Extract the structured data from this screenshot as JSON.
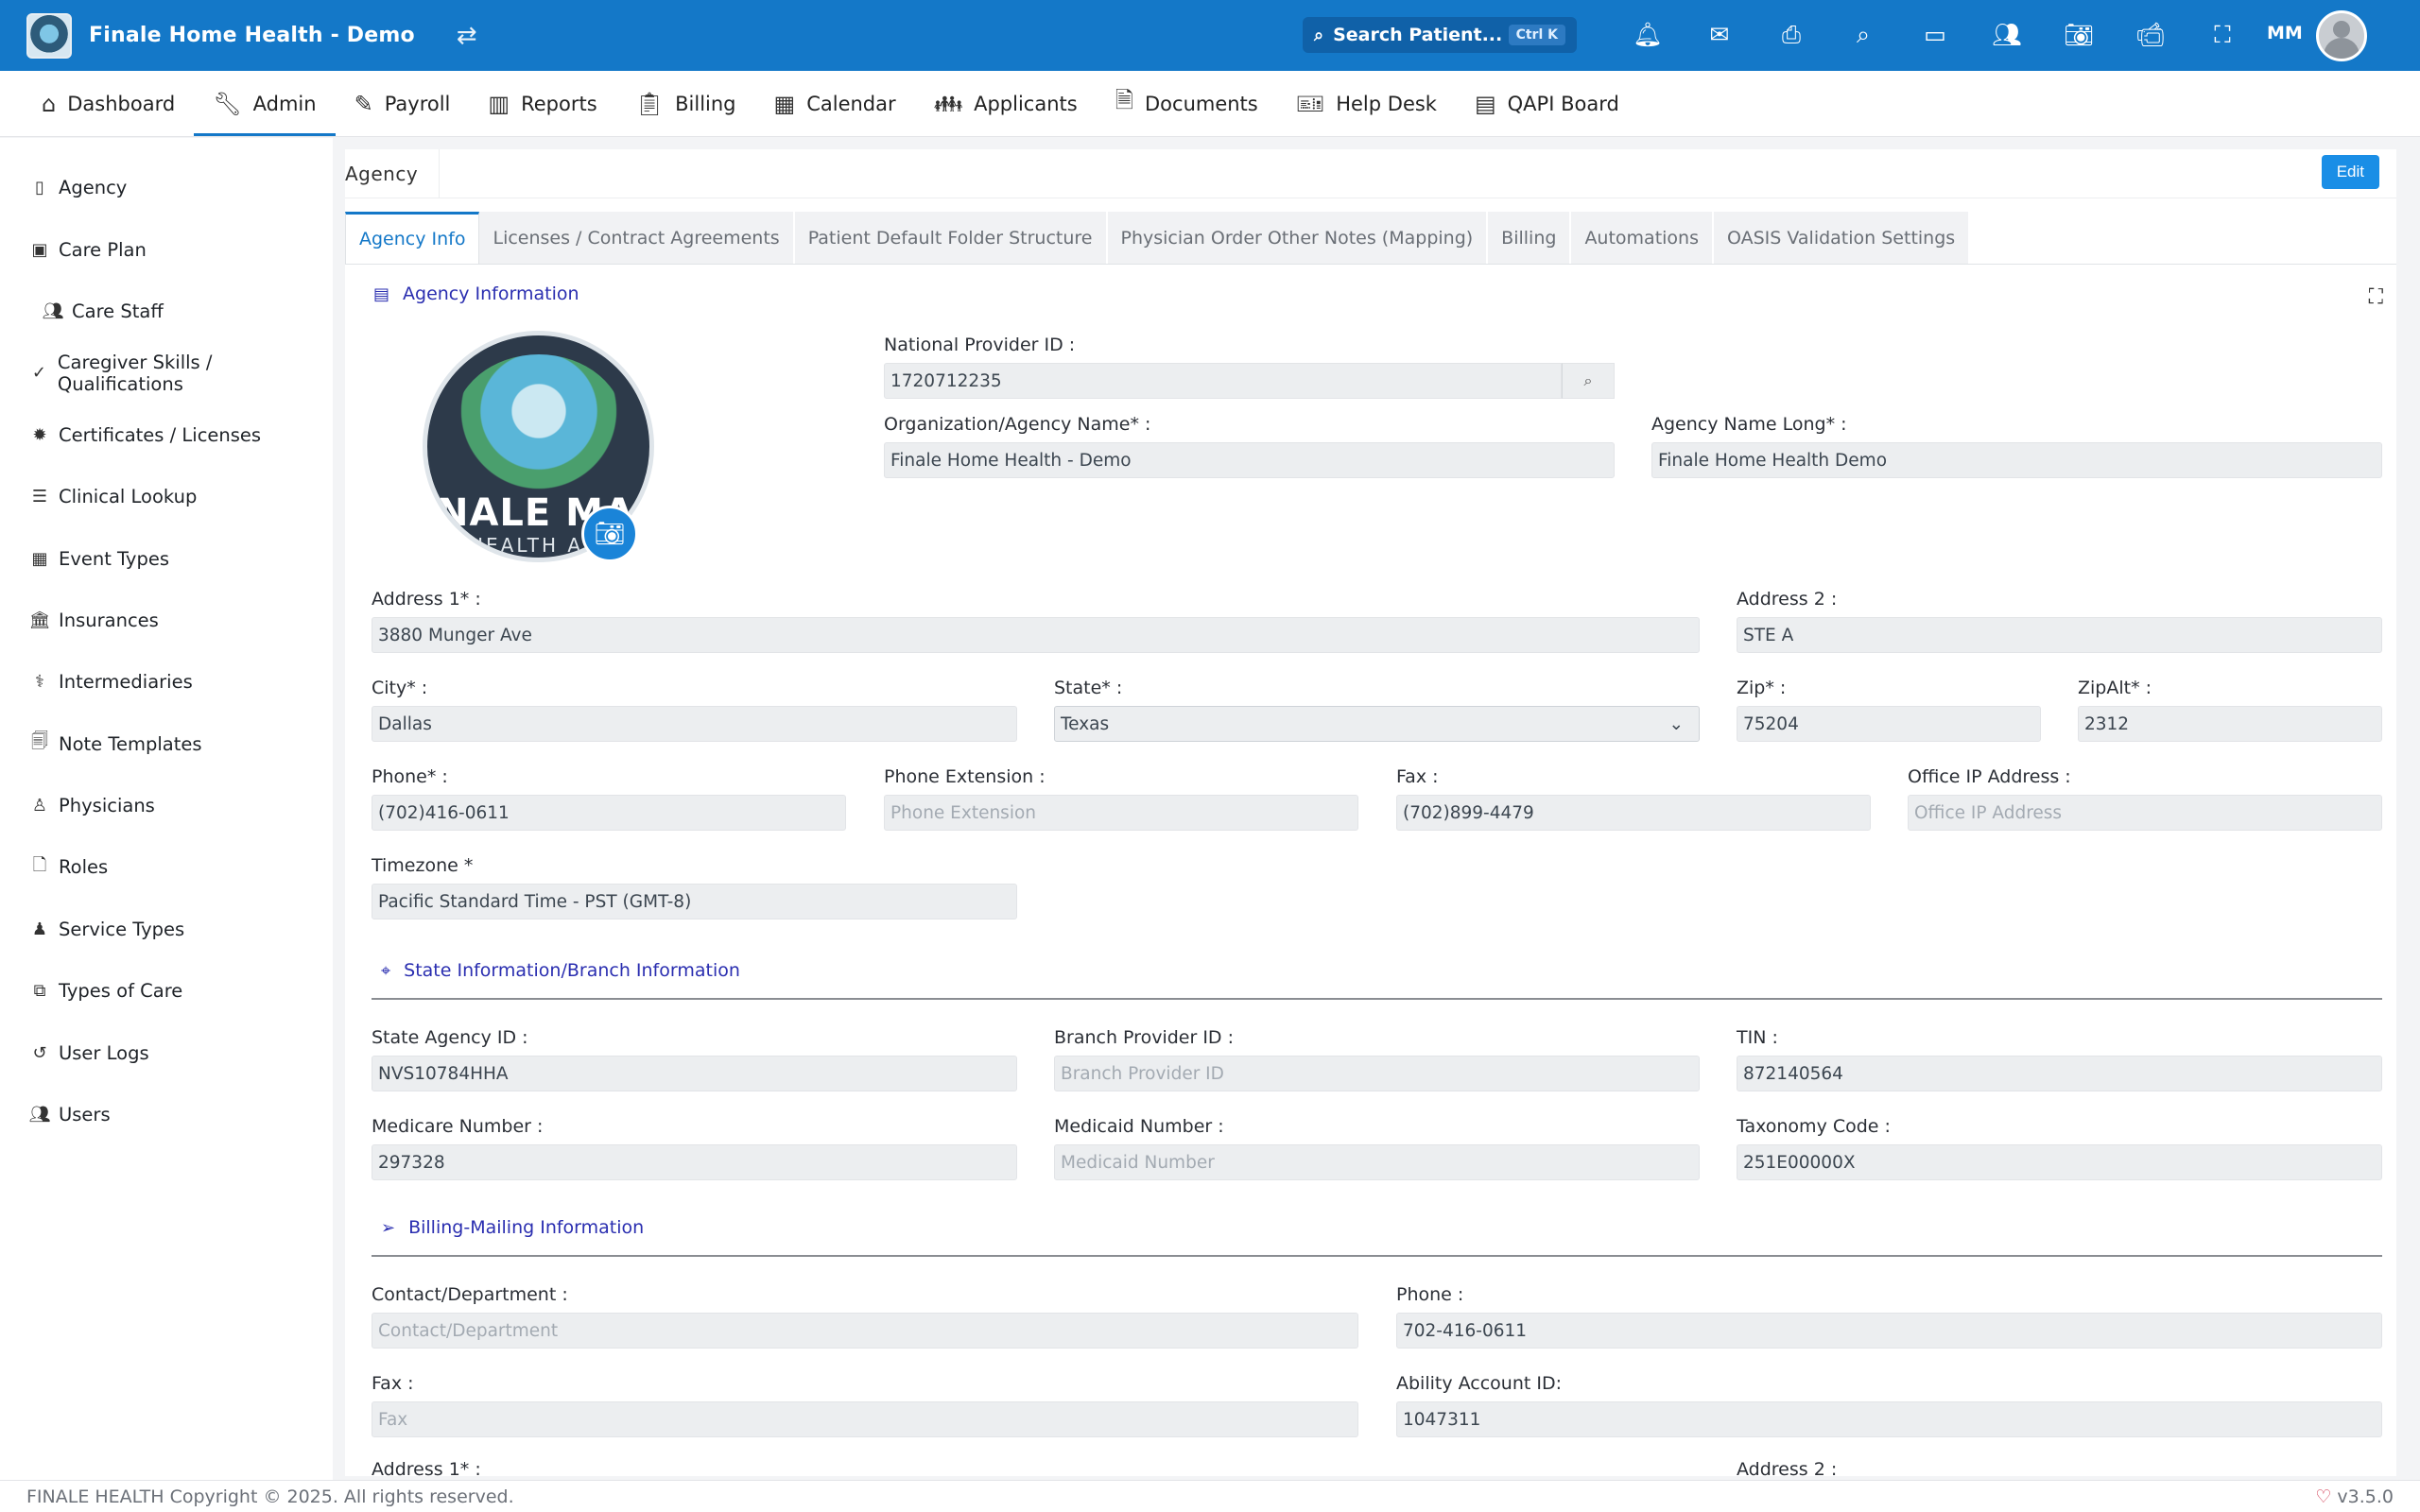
{
  "topbar": {
    "title": "Finale Home Health - Demo",
    "search_label": "Search Patient...",
    "search_shortcut": "Ctrl K",
    "user_initials": "MM"
  },
  "nav": [
    {
      "label": "Dashboard",
      "icon": "home-icon"
    },
    {
      "label": "Admin",
      "icon": "wrench-icon",
      "active": true
    },
    {
      "label": "Payroll",
      "icon": "edit-icon"
    },
    {
      "label": "Reports",
      "icon": "bar-chart-icon"
    },
    {
      "label": "Billing",
      "icon": "clipboard-icon"
    },
    {
      "label": "Calendar",
      "icon": "calendar-icon"
    },
    {
      "label": "Applicants",
      "icon": "people-icon"
    },
    {
      "label": "Documents",
      "icon": "pdf-icon"
    },
    {
      "label": "Help Desk",
      "icon": "ticket-icon"
    },
    {
      "label": "QAPI Board",
      "icon": "board-icon"
    }
  ],
  "sidebar": [
    {
      "label": "Agency",
      "icon": "building-icon"
    },
    {
      "label": "Care Plan",
      "icon": "care-plan-icon"
    },
    {
      "label": "Care Staff",
      "icon": "users-icon",
      "indent": true
    },
    {
      "label": "Caregiver Skills / Qualifications",
      "icon": "check-icon"
    },
    {
      "label": "Certificates / Licenses",
      "icon": "certificate-icon"
    },
    {
      "label": "Clinical Lookup",
      "icon": "list-icon"
    },
    {
      "label": "Event Types",
      "icon": "calendar-icon"
    },
    {
      "label": "Insurances",
      "icon": "bank-icon"
    },
    {
      "label": "Intermediaries",
      "icon": "stethoscope-icon"
    },
    {
      "label": "Note Templates",
      "icon": "template-icon"
    },
    {
      "label": "Physicians",
      "icon": "doctor-icon"
    },
    {
      "label": "Roles",
      "icon": "file-icon"
    },
    {
      "label": "Service Types",
      "icon": "service-icon"
    },
    {
      "label": "Types of Care",
      "icon": "copy-icon"
    },
    {
      "label": "User Logs",
      "icon": "history-icon"
    },
    {
      "label": "Users",
      "icon": "users-icon"
    }
  ],
  "main": {
    "breadcrumb": "Agency",
    "edit_label": "Edit",
    "tabs": [
      "Agency Info",
      "Licenses / Contract Agreements",
      "Patient Default Folder Structure",
      "Physician Order Other Notes (Mapping)",
      "Billing",
      "Automations",
      "OASIS Validation Settings"
    ]
  },
  "logo": {
    "text_main": "NALE MA",
    "text_sub": "HEALTH A"
  },
  "sections": {
    "agency_info": "Agency Information",
    "state_info": "State Information/Branch Information",
    "billing_mailing": "Billing-Mailing Information"
  },
  "fields": {
    "npi": {
      "label": "National Provider ID :",
      "value": "1720712235"
    },
    "org_name": {
      "label": "Organization/Agency Name* :",
      "value": "Finale Home Health - Demo"
    },
    "name_long": {
      "label": "Agency Name Long* :",
      "value": "Finale Home Health Demo"
    },
    "address1": {
      "label": "Address 1* :",
      "value": "3880 Munger Ave"
    },
    "address2": {
      "label": "Address 2 :",
      "value": "STE A"
    },
    "city": {
      "label": "City* :",
      "value": "Dallas"
    },
    "state": {
      "label": "State* :",
      "value": "Texas"
    },
    "zip": {
      "label": "Zip* :",
      "value": "75204"
    },
    "zipalt": {
      "label": "ZipAlt* :",
      "value": "2312"
    },
    "phone": {
      "label": "Phone* :",
      "value": "(702)416-0611"
    },
    "phone_ext": {
      "label": "Phone Extension :",
      "placeholder": "Phone Extension"
    },
    "fax": {
      "label": "Fax :",
      "value": "(702)899-4479"
    },
    "office_ip": {
      "label": "Office IP Address :",
      "placeholder": "Office IP Address"
    },
    "timezone": {
      "label": "Timezone *",
      "value": "Pacific Standard Time - PST (GMT-8)"
    },
    "state_agency_id": {
      "label": "State Agency ID :",
      "value": "NVS10784HHA"
    },
    "branch_provider_id": {
      "label": "Branch Provider ID :",
      "placeholder": "Branch Provider ID"
    },
    "tin": {
      "label": "TIN :",
      "value": "872140564"
    },
    "medicare": {
      "label": "Medicare Number :",
      "value": "297328"
    },
    "medicaid": {
      "label": "Medicaid Number :",
      "placeholder": "Medicaid Number"
    },
    "taxonomy": {
      "label": "Taxonomy Code :",
      "value": "251E00000X"
    },
    "contact_dept": {
      "label": "Contact/Department :",
      "placeholder": "Contact/Department"
    },
    "billing_phone": {
      "label": "Phone :",
      "value": "702-416-0611"
    },
    "billing_fax": {
      "label": "Fax :",
      "placeholder": "Fax"
    },
    "ability_account": {
      "label": "Ability Account ID:",
      "value": "1047311"
    },
    "billing_address1": {
      "label": "Address 1* :"
    },
    "billing_address2": {
      "label": "Address 2 :"
    }
  },
  "footer": {
    "copyright": "FINALE HEALTH Copyright © 2025. All rights reserved.",
    "version": "v3.5.0"
  }
}
